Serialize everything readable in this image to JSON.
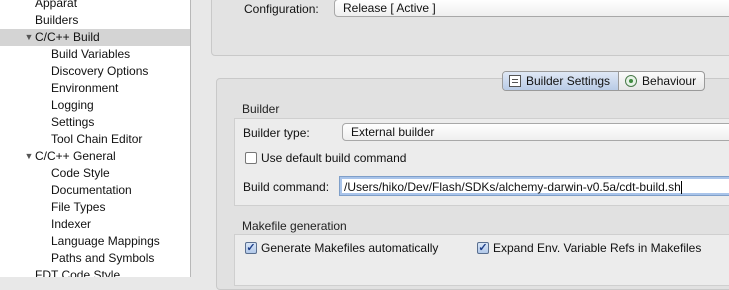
{
  "sidebar": {
    "items": [
      {
        "label": "Apparat",
        "disclosure": ""
      },
      {
        "label": "Builders",
        "disclosure": ""
      },
      {
        "label": "C/C++ Build",
        "disclosure": "▼"
      },
      {
        "label": "Build Variables",
        "disclosure": ""
      },
      {
        "label": "Discovery Options",
        "disclosure": ""
      },
      {
        "label": "Environment",
        "disclosure": ""
      },
      {
        "label": "Logging",
        "disclosure": ""
      },
      {
        "label": "Settings",
        "disclosure": ""
      },
      {
        "label": "Tool Chain Editor",
        "disclosure": ""
      },
      {
        "label": "C/C++ General",
        "disclosure": "▼"
      },
      {
        "label": "Code Style",
        "disclosure": ""
      },
      {
        "label": "Documentation",
        "disclosure": ""
      },
      {
        "label": "File Types",
        "disclosure": ""
      },
      {
        "label": "Indexer",
        "disclosure": ""
      },
      {
        "label": "Language Mappings",
        "disclosure": ""
      },
      {
        "label": "Paths and Symbols",
        "disclosure": ""
      },
      {
        "label": "FDT Code Style",
        "disclosure": ""
      }
    ],
    "selected": "C/C++ Build"
  },
  "configuration": {
    "label": "Configuration:",
    "value": "Release  [ Active ]"
  },
  "tabs": [
    {
      "label": "Builder Settings",
      "icon": "document-icon",
      "active": true
    },
    {
      "label": "Behaviour",
      "icon": "behaviour-icon",
      "active": false
    }
  ],
  "builder": {
    "section_title": "Builder",
    "type_label": "Builder type:",
    "type_value": "External builder",
    "use_default_label": "Use default build command",
    "use_default_checked": false,
    "command_label": "Build command:",
    "command_value": "/Users/hiko/Dev/Flash/SDKs/alchemy-darwin-v0.5a/cdt-build.sh"
  },
  "makefile": {
    "section_title": "Makefile generation",
    "generate_label": "Generate Makefiles automatically",
    "generate_checked": true,
    "expand_label": "Expand Env. Variable Refs in Makefiles",
    "expand_checked": true
  }
}
